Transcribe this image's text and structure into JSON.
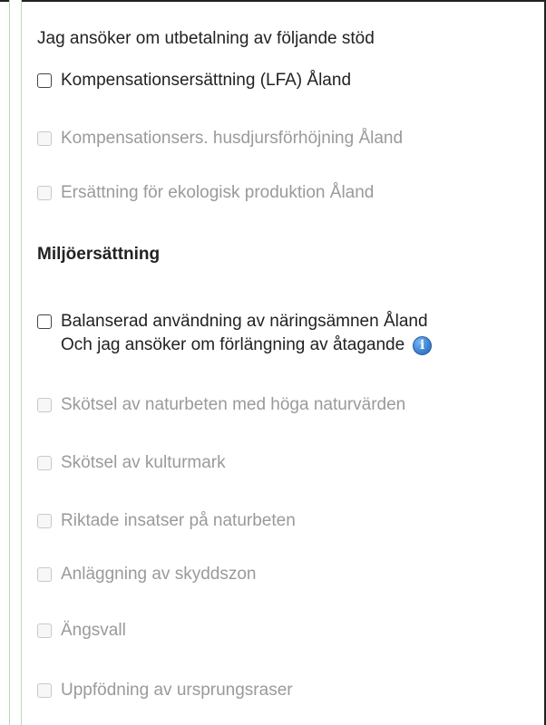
{
  "form": {
    "intro": "Jag ansöker om utbetalning av följande stöd",
    "support_options": [
      {
        "label": "Kompensationsersättning (LFA) Åland",
        "enabled": true,
        "checked": false
      },
      {
        "label": "Kompensationsers. husdjursförhöjning Åland",
        "enabled": false,
        "checked": false
      },
      {
        "label": "Ersättning för ekologisk produktion Åland",
        "enabled": false,
        "checked": false
      }
    ],
    "environment_heading": "Miljöersättning",
    "environment_options": [
      {
        "label": "Balanserad användning av näringsämnen Åland",
        "enabled": true,
        "checked": false
      },
      {
        "label": "Skötsel av naturbeten med höga naturvärden",
        "enabled": false,
        "checked": false
      },
      {
        "label": "Skötsel av kulturmark",
        "enabled": false,
        "checked": false
      },
      {
        "label": "Riktade insatser på naturbeten",
        "enabled": false,
        "checked": false
      },
      {
        "label": "Anläggning av skyddszon",
        "enabled": false,
        "checked": false
      },
      {
        "label": "Ängsvall",
        "enabled": false,
        "checked": false
      },
      {
        "label": "Uppfödning av ursprungsraser",
        "enabled": false,
        "checked": false
      }
    ],
    "extension_text": "Och jag ansöker om förlängning av åtagande",
    "info_icon_glyph": "i"
  },
  "colors": {
    "text": "#222222",
    "disabled_text": "#9a9a9a",
    "rail_border": "#b9dbb6",
    "info_blue": "#3d85d3"
  },
  "icons": {
    "info": "info-icon"
  }
}
